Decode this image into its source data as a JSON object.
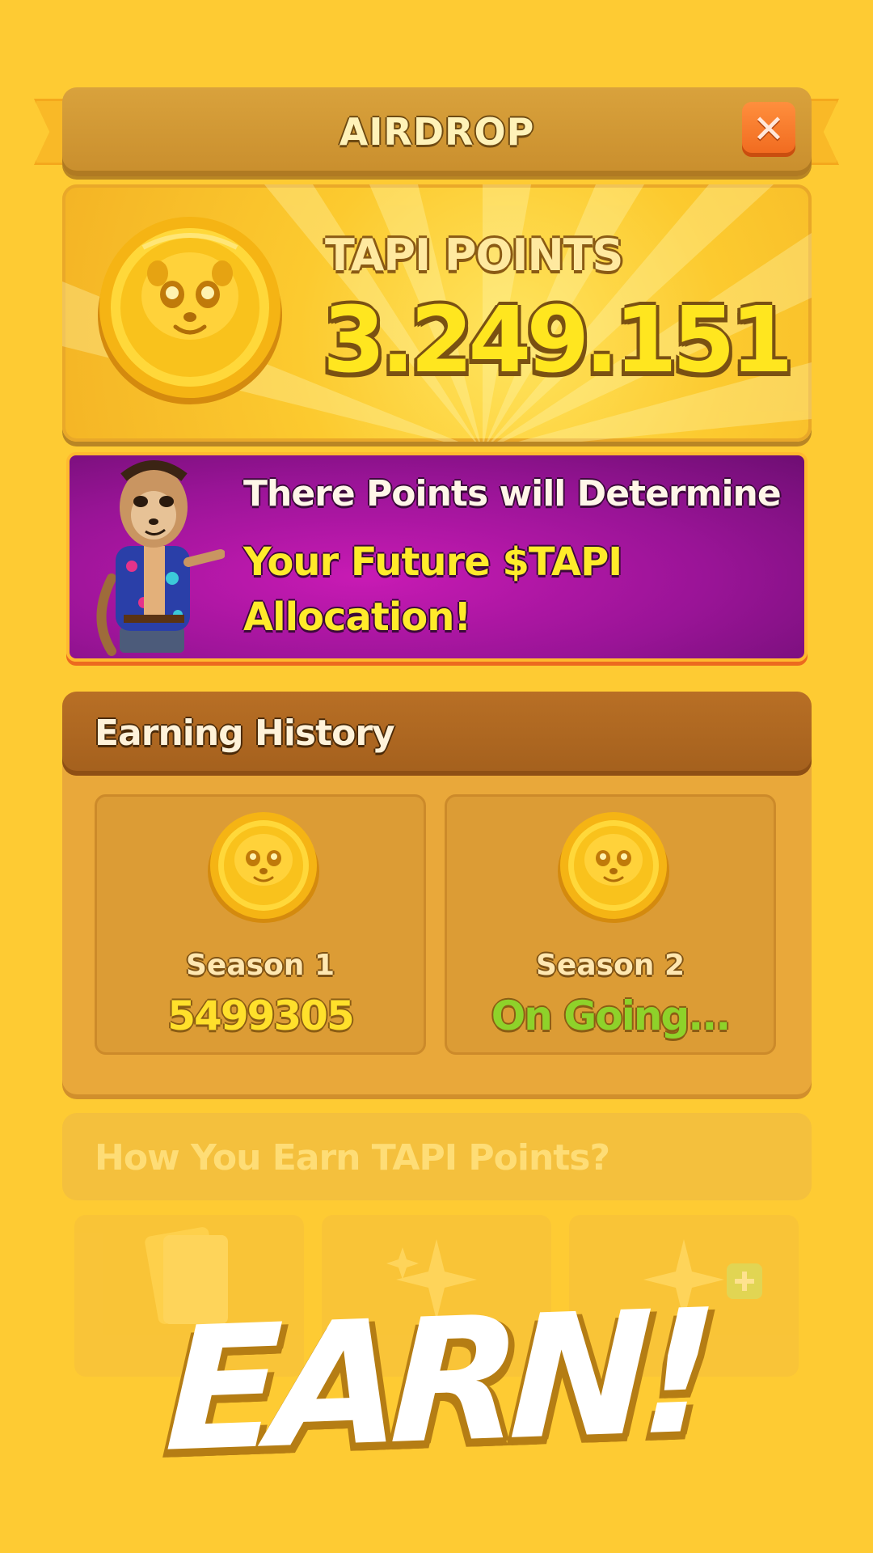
{
  "header": {
    "title": "AIRDROP",
    "close_icon": "close-x-icon"
  },
  "points": {
    "label": "TAPI POINTS",
    "value": "3.249.151",
    "icon": "meerkat-coin-icon"
  },
  "promo": {
    "line1": "There Points will Determine",
    "line2": "Your Future $TAPI Allocation!",
    "character": "meerkat-character"
  },
  "history": {
    "title": "Earning History",
    "seasons": [
      {
        "name": "Season 1",
        "value": "5499305"
      },
      {
        "name": "Season 2",
        "value": "On Going..."
      }
    ]
  },
  "howto": {
    "title": "How You Earn TAPI Points?"
  },
  "banner": {
    "text": "EARN!"
  },
  "colors": {
    "background": "#FECB33",
    "promo_purple": "#9A1497",
    "highlight_yellow": "#FFEB2A",
    "ongoing_green": "#8ED22A",
    "close_orange": "#F0691E"
  }
}
